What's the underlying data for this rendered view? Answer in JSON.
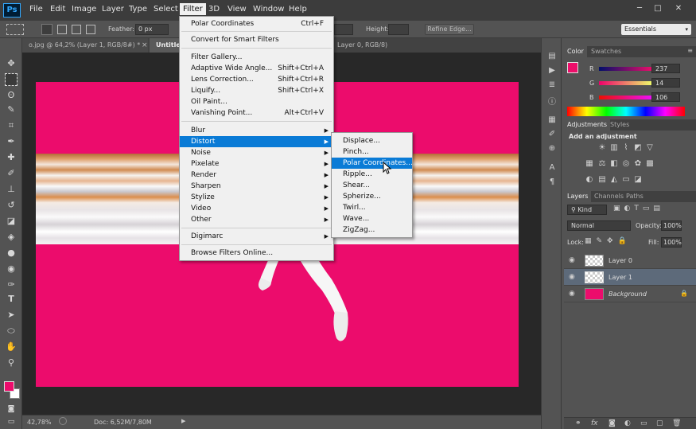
{
  "app": {
    "logo": "Ps"
  },
  "menubar": [
    "File",
    "Edit",
    "Image",
    "Layer",
    "Type",
    "Select",
    "Filter",
    "3D",
    "View",
    "Window",
    "Help"
  ],
  "window_controls": {
    "minimize": "─",
    "restore": "□",
    "close": "✕"
  },
  "options": {
    "feather_label": "Feather:",
    "feather_value": "0 px",
    "height_label": "Height:",
    "refine_edge": "Refine Edge...",
    "workspace": "Essentials"
  },
  "tabs": {
    "tab1": "o.jpg @ 64,2% (Layer 1, RGB/8#) *",
    "tab1_close": "×",
    "tab2": "Untitled",
    "tab3": "Layer 0, RGB/8)"
  },
  "status": {
    "zoom": "42,78%",
    "doc": "Doc: 6,52M/7,80M"
  },
  "filter_menu": {
    "items": [
      {
        "label": "Polar Coordinates",
        "shortcut": "Ctrl+F"
      },
      {
        "label": "Convert for Smart Filters",
        "shortcut": ""
      },
      {
        "label": "Filter Gallery...",
        "shortcut": ""
      },
      {
        "label": "Adaptive Wide Angle...",
        "shortcut": "Shift+Ctrl+A"
      },
      {
        "label": "Lens Correction...",
        "shortcut": "Shift+Ctrl+R"
      },
      {
        "label": "Liquify...",
        "shortcut": "Shift+Ctrl+X"
      },
      {
        "label": "Oil Paint...",
        "shortcut": ""
      },
      {
        "label": "Vanishing Point...",
        "shortcut": "Alt+Ctrl+V"
      },
      {
        "label": "Blur",
        "shortcut": ""
      },
      {
        "label": "Distort",
        "shortcut": ""
      },
      {
        "label": "Noise",
        "shortcut": ""
      },
      {
        "label": "Pixelate",
        "shortcut": ""
      },
      {
        "label": "Render",
        "shortcut": ""
      },
      {
        "label": "Sharpen",
        "shortcut": ""
      },
      {
        "label": "Stylize",
        "shortcut": ""
      },
      {
        "label": "Video",
        "shortcut": ""
      },
      {
        "label": "Other",
        "shortcut": ""
      },
      {
        "label": "Digimarc",
        "shortcut": ""
      },
      {
        "label": "Browse Filters Online...",
        "shortcut": ""
      }
    ]
  },
  "distort_menu": {
    "items": [
      "Displace...",
      "Pinch...",
      "Polar Coordinates...",
      "Ripple...",
      "Shear...",
      "Spherize...",
      "Twirl...",
      "Wave...",
      "ZigZag..."
    ]
  },
  "color_panel": {
    "tabs": [
      "Color",
      "Swatches"
    ],
    "r_label": "R",
    "r_value": "237",
    "g_label": "G",
    "g_value": "14",
    "b_label": "B",
    "b_value": "106",
    "foreground": "#ed0e6a"
  },
  "adjustments_panel": {
    "tabs": [
      "Adjustments",
      "Styles"
    ],
    "heading": "Add an adjustment"
  },
  "layers_panel": {
    "tabs": [
      "Layers",
      "Channels",
      "Paths"
    ],
    "kind": "Kind",
    "blend_mode": "Normal",
    "opacity_label": "Opacity:",
    "opacity_value": "100%",
    "lock_label": "Lock:",
    "fill_label": "Fill:",
    "fill_value": "100%",
    "layers": [
      {
        "name": "Layer 0"
      },
      {
        "name": "Layer 1"
      },
      {
        "name": "Background"
      }
    ],
    "footer_icons": [
      "link-icon",
      "fx-icon",
      "mask-icon",
      "adjustment-layer-icon",
      "group-icon",
      "new-layer-icon",
      "trash-icon"
    ]
  },
  "colors": {
    "accent": "#ec0c6c",
    "menu_highlight": "#0a7bd6"
  }
}
